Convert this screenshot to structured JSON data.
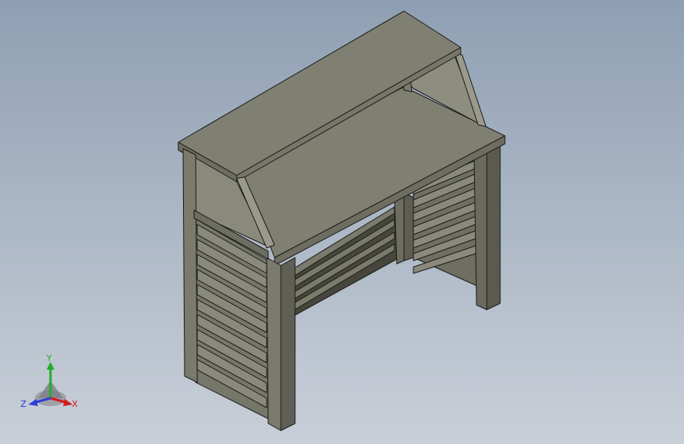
{
  "viewport": {
    "model": "bar-counter-assembly"
  },
  "triad": {
    "x_label": "X",
    "y_label": "Y",
    "z_label": "Z",
    "x_color": "#d21c1c",
    "y_color": "#1fae2a",
    "z_color": "#2a3fd6"
  },
  "colors": {
    "face_top": "#7f7f72",
    "face_light": "#8a8a7c",
    "face_mid": "#76766a",
    "face_dark": "#5d5d52",
    "edge": "#1c1c18",
    "interior": "#46463d"
  }
}
